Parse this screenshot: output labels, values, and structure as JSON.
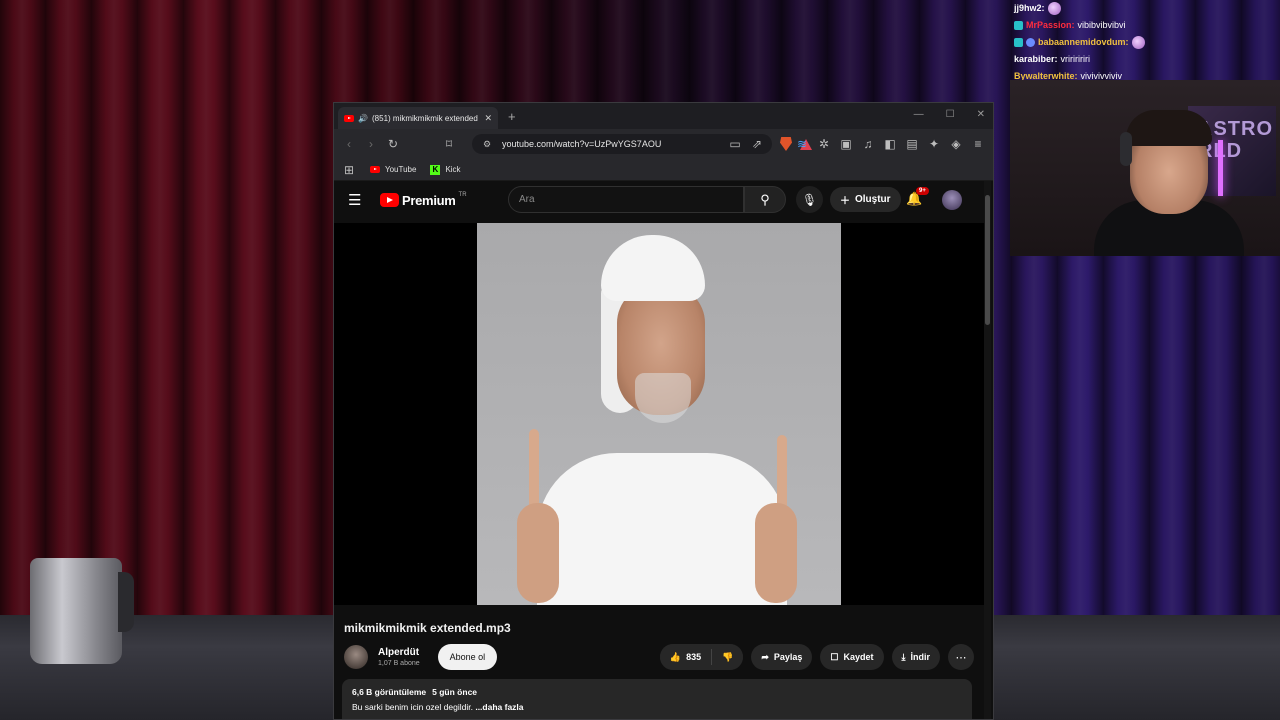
{
  "chat": {
    "messages": [
      {
        "user": "jj9hw2:",
        "user_color": "#ffffff",
        "message": "",
        "badge": false,
        "emote": true
      },
      {
        "user": "MrPassion:",
        "user_color": "#ff2c3e",
        "message": "vibibvibvibvi",
        "badge": true,
        "emote": false
      },
      {
        "user": "babaannemidovdum:",
        "user_color": "#f0c040",
        "message": "",
        "badge": true,
        "emote": true
      },
      {
        "user": "karabiber:",
        "user_color": "#ffffff",
        "message": "vririririri",
        "badge": false,
        "emote": false
      },
      {
        "user": "Bywalterwhite:",
        "user_color": "#f0c040",
        "message": "vivivivviviv",
        "badge": false,
        "emote": false
      }
    ]
  },
  "webcam": {
    "poster_text": "ASTRO\nRLD"
  },
  "browser": {
    "tab_title": "(851) mikmikmikmik extended",
    "tab_close": "✕",
    "new_tab": "+",
    "win_minimize": "—",
    "win_maximize": "☐",
    "win_close": "✕",
    "url": "youtube.com/watch?v=UzPwYGS7AOU",
    "bookmarks": [
      {
        "label": "YouTube"
      },
      {
        "label": "Kick"
      }
    ]
  },
  "youtube": {
    "logo_text": "Premium",
    "region": "TR",
    "search_placeholder": "Ara",
    "create_label": "Oluştur",
    "notification_count": "9+",
    "video_title": "mikmikmikmik extended.mp3",
    "channel_name": "Alperdüt",
    "subscribers": "1,07 B abone",
    "subscribe_label": "Abone ol",
    "likes": "835",
    "share_label": "Paylaş",
    "save_label": "Kaydet",
    "download_label": "İndir",
    "views": "6,6 B görüntüleme",
    "uploaded": "5 gün önce",
    "description": "Bu sarki benim icin ozel degildir.",
    "more_label": "...daha fazla"
  },
  "colors": {
    "yt_red": "#ff0000",
    "kick_green": "#53fc18",
    "brave_orange": "#e0542a"
  }
}
